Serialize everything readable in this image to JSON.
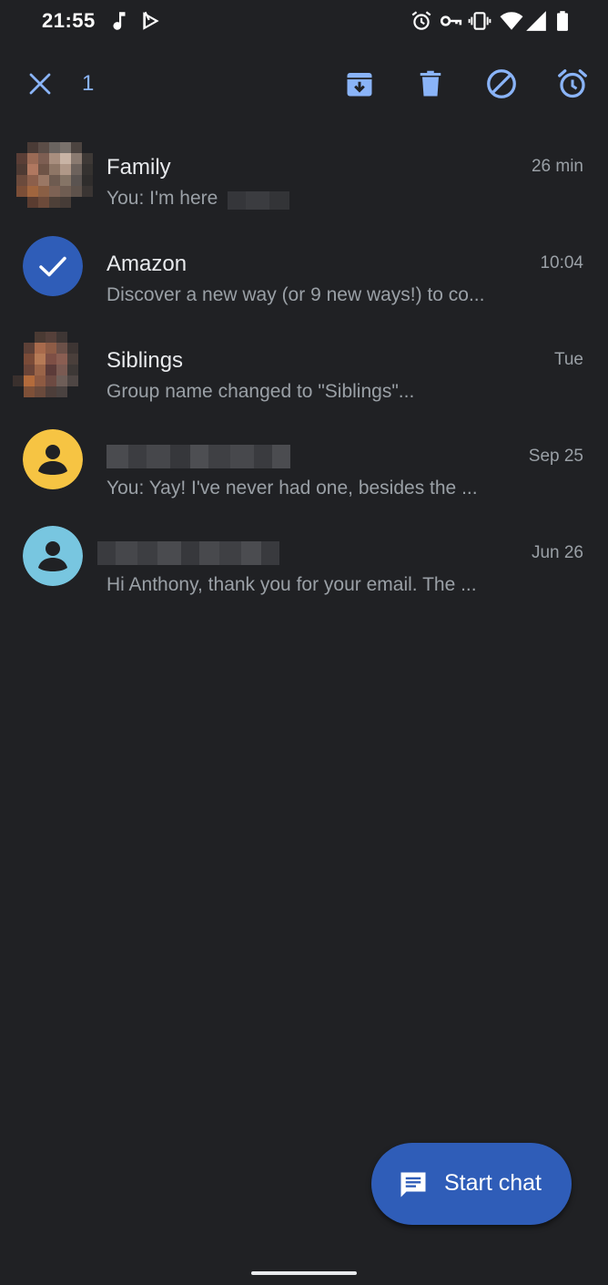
{
  "status_bar": {
    "time": "21:55",
    "left_icons": [
      "music-note-icon",
      "play-store-icon"
    ],
    "right_icons": [
      "alarm-icon",
      "vpn-key-icon",
      "vibrate-icon",
      "wifi-icon",
      "signal-icon",
      "battery-icon"
    ]
  },
  "action_bar": {
    "close_icon": "close-icon",
    "selected_count": "1",
    "actions": [
      "archive-icon",
      "delete-icon",
      "block-icon",
      "snooze-icon"
    ],
    "accent_color": "#8ab4f8"
  },
  "conversations": [
    {
      "name": "Family",
      "snippet": "You: I'm here",
      "time": "26 min",
      "avatar": "group-photo"
    },
    {
      "name": "Amazon",
      "snippet": "Discover a new way (or 9 new ways!) to co...",
      "time": "10:04",
      "avatar": "selected-check",
      "selected": true
    },
    {
      "name": "Siblings",
      "snippet": "Group name changed to \"Siblings\"...",
      "time": "Tue",
      "avatar": "group-photo"
    },
    {
      "name": "",
      "snippet": "You: Yay! I've never had one, besides the ...",
      "time": "Sep 25",
      "avatar": "person-icon",
      "avatar_color": "#f6c443"
    },
    {
      "name": "",
      "snippet": "Hi Anthony, thank you for your email. The ...",
      "time": "Jun 26",
      "avatar": "person-icon",
      "avatar_color": "#78c6e0"
    }
  ],
  "fab": {
    "label": "Start chat",
    "icon": "message-icon",
    "color": "#2f5db8"
  },
  "colors": {
    "background": "#202124",
    "primary_text": "#e8eaed",
    "secondary_text": "#9aa0a6",
    "selected_avatar": "#2f5db8"
  }
}
